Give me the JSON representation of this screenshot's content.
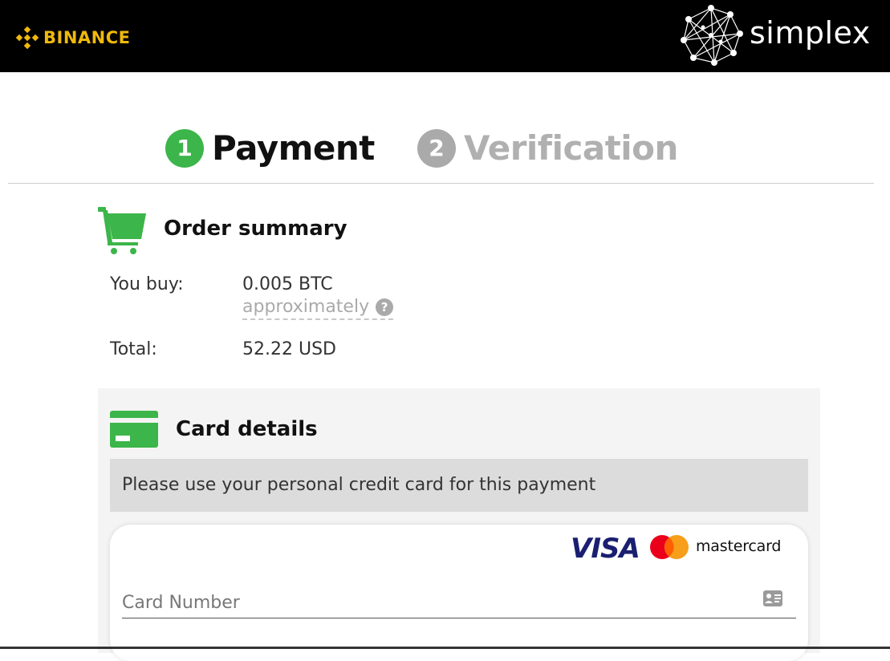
{
  "header": {
    "left_brand": "BINANCE",
    "right_brand": "simplex",
    "colors": {
      "binance": "#F0B90B",
      "bar": "#000000"
    }
  },
  "steps": [
    {
      "number": "1",
      "label": "Payment",
      "state": "active",
      "color": "#3cb54a"
    },
    {
      "number": "2",
      "label": "Verification",
      "state": "inactive",
      "color": "#aaaaaa"
    }
  ],
  "order_summary": {
    "icon": "shopping-cart-icon",
    "title": "Order summary",
    "you_buy_label": "You buy:",
    "you_buy_value": "0.005 BTC",
    "approx_text": "approximately",
    "help_glyph": "?",
    "total_label": "Total:",
    "total_value": "52.22 USD"
  },
  "card_details": {
    "icon": "credit-card-icon",
    "title": "Card details",
    "notice": "Please use your personal credit card for this payment",
    "brands": [
      "VISA",
      "mastercard"
    ],
    "card_number_placeholder": "Card Number",
    "card_number_value": "",
    "input_icon": "id-card-icon"
  }
}
